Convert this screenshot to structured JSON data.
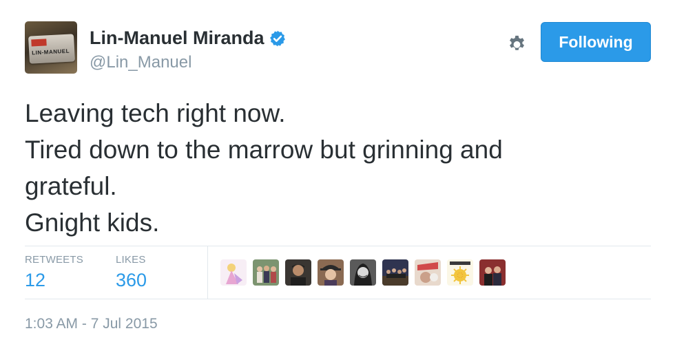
{
  "author": {
    "name": "Lin-Manuel Miranda",
    "handle": "@Lin_Manuel",
    "verified": true,
    "avatar_plate_text": "LIN-MANUEL",
    "avatar_icon": "license-plate-avatar",
    "verified_icon": "verified-badge-icon"
  },
  "actions": {
    "follow_label": "Following",
    "settings_icon": "gear-icon"
  },
  "tweet": {
    "lines": [
      "Leaving tech right now.",
      "Tired down to the marrow but grinning and",
      "grateful.",
      "Gnight kids."
    ]
  },
  "stats": {
    "retweets_label": "RETWEETS",
    "retweets_count": "12",
    "likes_label": "LIKES",
    "likes_count": "360"
  },
  "likers": [
    {
      "name": "liker-avatar-1",
      "color": "#f3e6f0"
    },
    {
      "name": "liker-avatar-2",
      "color": "#6f8a66"
    },
    {
      "name": "liker-avatar-3",
      "color": "#2e2b28"
    },
    {
      "name": "liker-avatar-4",
      "color": "#6a4a3a"
    },
    {
      "name": "liker-avatar-5",
      "color": "#4a4a4a"
    },
    {
      "name": "liker-avatar-6",
      "color": "#3d3a4e"
    },
    {
      "name": "liker-avatar-7",
      "color": "#c8b0a0"
    },
    {
      "name": "liker-avatar-8",
      "color": "#f5f0d8"
    },
    {
      "name": "liker-avatar-9",
      "color": "#7a3030"
    }
  ],
  "timestamp": "1:03 AM - 7 Jul 2015",
  "colors": {
    "accent": "#2b9ae8",
    "text": "#292f33",
    "muted": "#8899a6",
    "divider": "#e1e8ed"
  }
}
